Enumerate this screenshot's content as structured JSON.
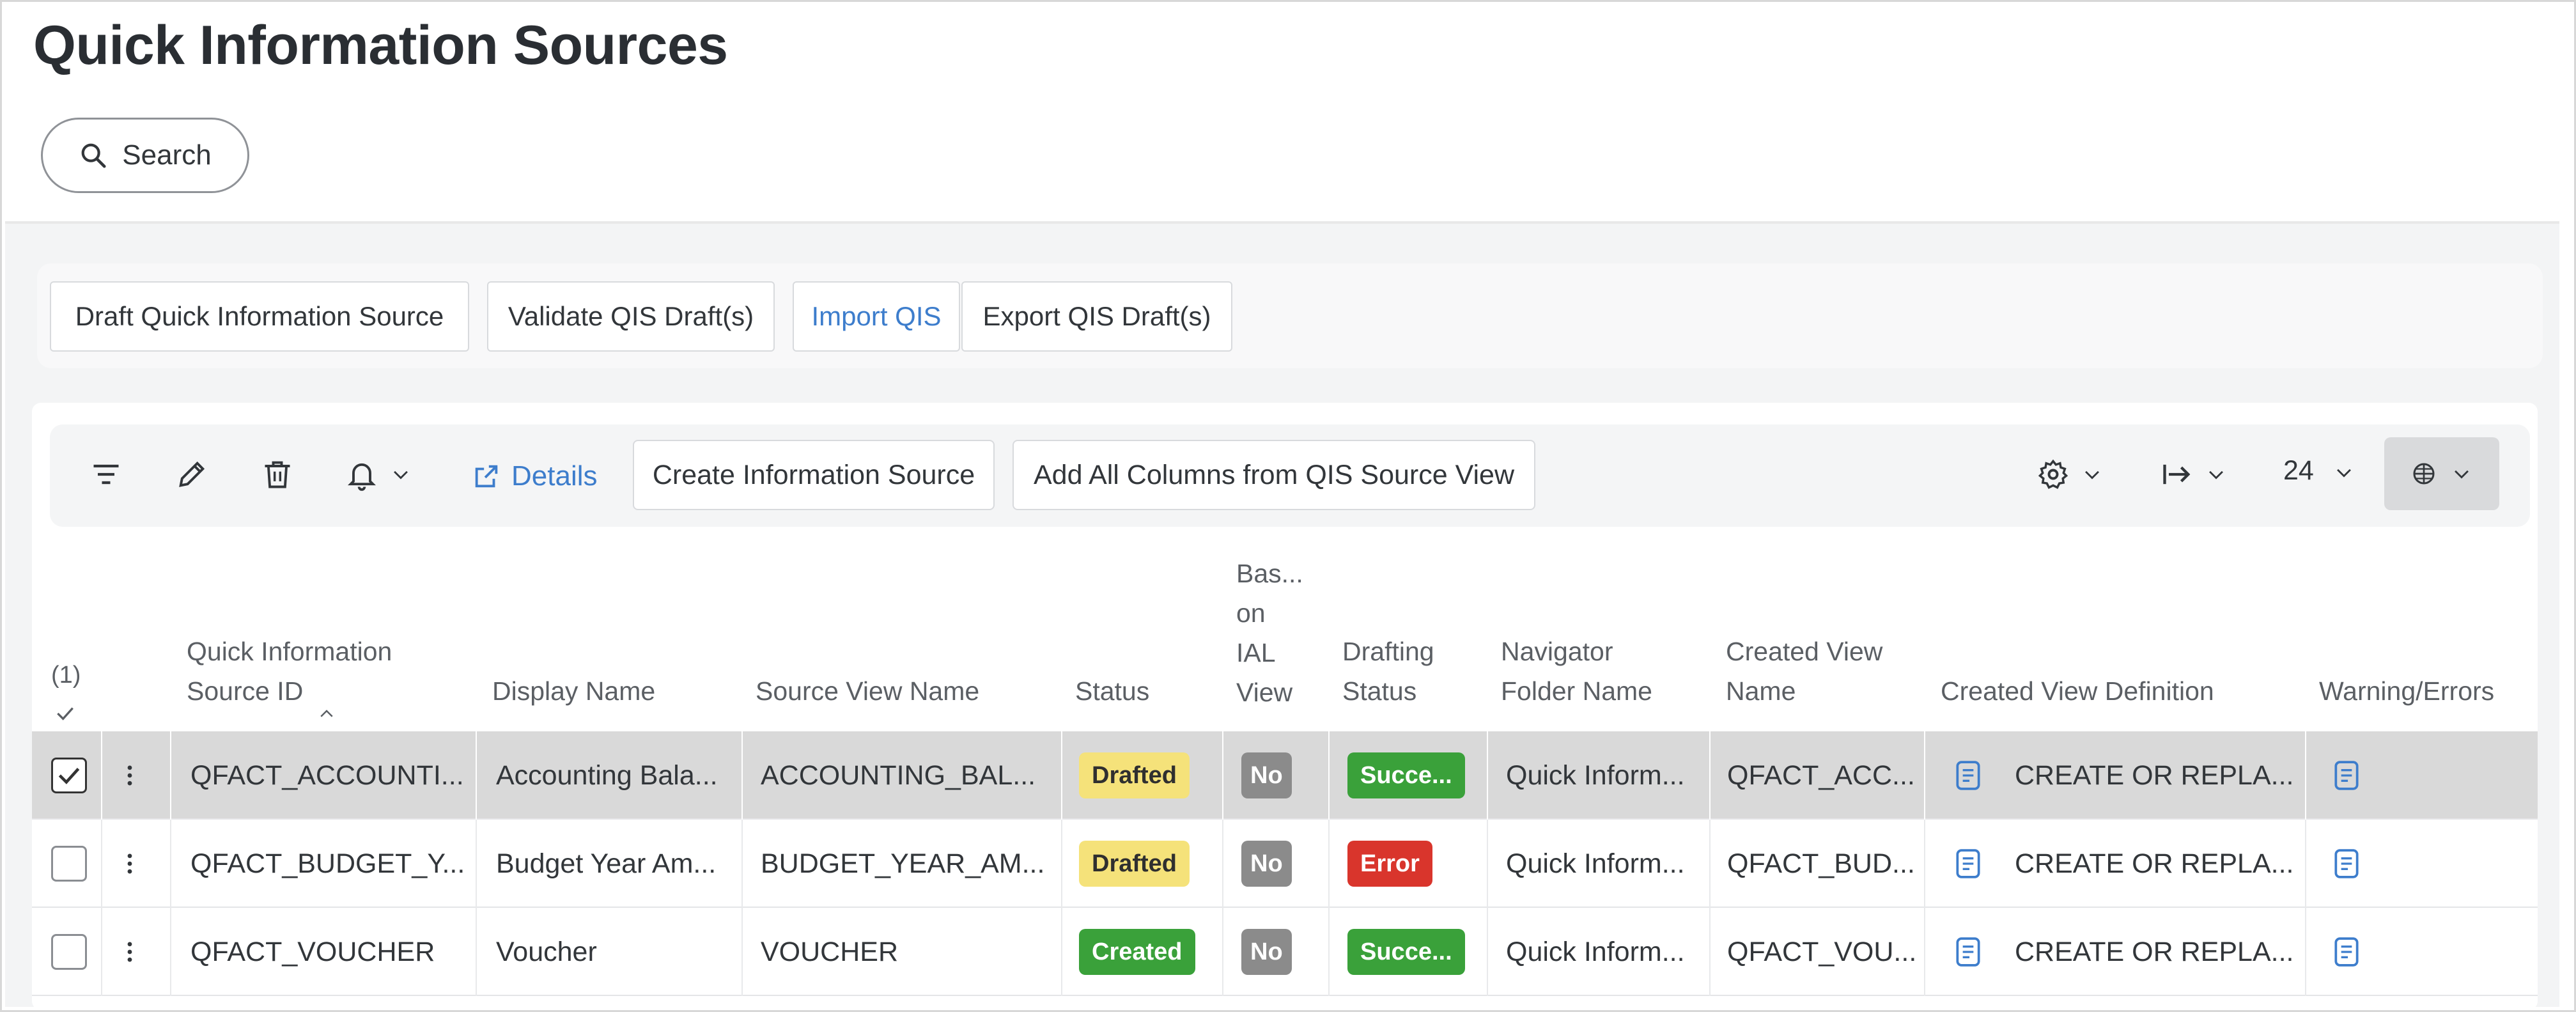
{
  "page": {
    "title": "Quick Information Sources"
  },
  "search": {
    "label": "Search"
  },
  "actions": {
    "draft": "Draft Quick Information Source",
    "validate": "Validate QIS Draft(s)",
    "import": "Import QIS",
    "export": "Export QIS Draft(s)"
  },
  "toolbar": {
    "details": "Details",
    "create_info_source": "Create Information Source",
    "add_all_columns": "Add All Columns from QIS Source View",
    "rows_per_page": "24"
  },
  "table": {
    "selection_count": "(1)",
    "columns": {
      "qis_id_1": "Quick Information",
      "qis_id_2": "Source ID",
      "display_name": "Display Name",
      "source_view_name": "Source View Name",
      "status": "Status",
      "based_1": "Bas...",
      "based_2": "on",
      "based_3": "IAL",
      "based_4": "View",
      "drafting_1": "Drafting",
      "drafting_2": "Status",
      "nav_1": "Navigator",
      "nav_2": "Folder Name",
      "created_view_1": "Created View",
      "created_view_2": "Name",
      "created_view_def": "Created View Definition",
      "warnings": "Warning/Errors"
    },
    "rows": [
      {
        "id": "QFACT_ACCOUNTI...",
        "display": "Accounting Bala...",
        "source_view": "ACCOUNTING_BAL...",
        "status": "Drafted",
        "ial": "No",
        "drafting": "Succe...",
        "folder": "Quick Inform...",
        "view_name": "QFACT_ACC...",
        "definition": "CREATE OR REPLA..."
      },
      {
        "id": "QFACT_BUDGET_Y...",
        "display": "Budget Year Am...",
        "source_view": "BUDGET_YEAR_AM...",
        "status": "Drafted",
        "ial": "No",
        "drafting": "Error",
        "folder": "Quick Inform...",
        "view_name": "QFACT_BUD...",
        "definition": "CREATE OR REPLA..."
      },
      {
        "id": "QFACT_VOUCHER",
        "display": "Voucher",
        "source_view": "VOUCHER",
        "status": "Created",
        "ial": "No",
        "drafting": "Succe...",
        "folder": "Quick Inform...",
        "view_name": "QFACT_VOU...",
        "definition": "CREATE OR REPLA..."
      }
    ]
  },
  "colors": {
    "accent": "#3d7dcc",
    "drafted": "#f5e27a",
    "success": "#3aa13a",
    "error": "#d9352c",
    "neutral": "#8b8b8b"
  }
}
